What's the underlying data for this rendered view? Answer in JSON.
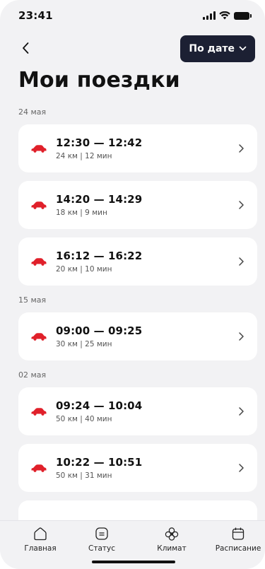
{
  "status_bar": {
    "time": "23:41"
  },
  "header": {
    "sort_label": "По дате",
    "title": "Мои поездки"
  },
  "groups": [
    {
      "date": "24 мая",
      "trips": [
        {
          "time": "12:30 — 12:42",
          "meta": "24 км | 12 мин"
        },
        {
          "time": "14:20 — 14:29",
          "meta": "18 км | 9 мин"
        },
        {
          "time": "16:12 — 16:22",
          "meta": "20 км | 10 мин"
        }
      ]
    },
    {
      "date": "15 мая",
      "trips": [
        {
          "time": "09:00 — 09:25",
          "meta": "30 км | 25 мин"
        }
      ]
    },
    {
      "date": "02 мая",
      "trips": [
        {
          "time": "09:24 — 10:04",
          "meta": "50 км | 40 мин"
        },
        {
          "time": "10:22 — 10:51",
          "meta": "50 км | 31 мин"
        }
      ]
    }
  ],
  "nav": {
    "items": [
      {
        "label": "Главная",
        "icon": "home-icon"
      },
      {
        "label": "Статус",
        "icon": "status-icon"
      },
      {
        "label": "Климат",
        "icon": "climate-icon"
      },
      {
        "label": "Расписание",
        "icon": "calendar-icon"
      }
    ]
  },
  "colors": {
    "accent": "#e0202a",
    "dark_button": "#1c2033",
    "background": "#f2f2f4"
  }
}
